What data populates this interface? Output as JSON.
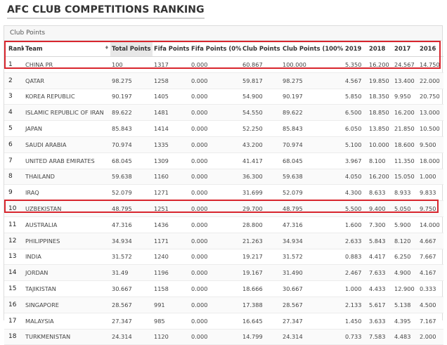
{
  "page": {
    "title": "AFC CLUB COMPETITIONS RANKING",
    "panel_title": "Club Points"
  },
  "table": {
    "columns": [
      {
        "label": "Rank",
        "sortable": false
      },
      {
        "label": "Team",
        "sortable": true
      },
      {
        "label": "Total Points",
        "sortable": true,
        "sorted": "desc"
      },
      {
        "label": "Fifa Points",
        "sortable": true
      },
      {
        "label": "Fifa Points (0%)",
        "sortable": true
      },
      {
        "label": "Club Points",
        "sortable": true
      },
      {
        "label": "Club Points (100%)",
        "sortable": true
      },
      {
        "label": "2019",
        "sortable": false
      },
      {
        "label": "2018",
        "sortable": false
      },
      {
        "label": "2017",
        "sortable": false
      },
      {
        "label": "2016",
        "sortable": false
      }
    ],
    "rows": [
      [
        "1",
        "CHINA PR",
        "100",
        "1317",
        "0.000",
        "60.867",
        "100.000",
        "5.350",
        "16.200",
        "24.567",
        "14.750"
      ],
      [
        "2",
        "QATAR",
        "98.275",
        "1258",
        "0.000",
        "59.817",
        "98.275",
        "4.567",
        "19.850",
        "13.400",
        "22.000"
      ],
      [
        "3",
        "KOREA REPUBLIC",
        "90.197",
        "1405",
        "0.000",
        "54.900",
        "90.197",
        "5.850",
        "18.350",
        "9.950",
        "20.750"
      ],
      [
        "4",
        "ISLAMIC REPUBLIC OF IRAN",
        "89.622",
        "1481",
        "0.000",
        "54.550",
        "89.622",
        "6.500",
        "18.850",
        "16.200",
        "13.000"
      ],
      [
        "5",
        "JAPAN",
        "85.843",
        "1414",
        "0.000",
        "52.250",
        "85.843",
        "6.050",
        "13.850",
        "21.850",
        "10.500"
      ],
      [
        "6",
        "SAUDI ARABIA",
        "70.974",
        "1335",
        "0.000",
        "43.200",
        "70.974",
        "5.100",
        "10.000",
        "18.600",
        "9.500"
      ],
      [
        "7",
        "UNITED ARAB EMIRATES",
        "68.045",
        "1309",
        "0.000",
        "41.417",
        "68.045",
        "3.967",
        "8.100",
        "11.350",
        "18.000"
      ],
      [
        "8",
        "THAILAND",
        "59.638",
        "1160",
        "0.000",
        "36.300",
        "59.638",
        "4.050",
        "16.200",
        "15.050",
        "1.000"
      ],
      [
        "9",
        "IRAQ",
        "52.079",
        "1271",
        "0.000",
        "31.699",
        "52.079",
        "4.300",
        "8.633",
        "8.933",
        "9.833"
      ],
      [
        "10",
        "UZBEKISTAN",
        "48.795",
        "1251",
        "0.000",
        "29.700",
        "48.795",
        "5.500",
        "9.400",
        "5.050",
        "9.750"
      ],
      [
        "11",
        "AUSTRALIA",
        "47.316",
        "1436",
        "0.000",
        "28.800",
        "47.316",
        "1.600",
        "7.300",
        "5.900",
        "14.000"
      ],
      [
        "12",
        "PHILIPPINES",
        "34.934",
        "1171",
        "0.000",
        "21.263",
        "34.934",
        "2.633",
        "5.843",
        "8.120",
        "4.667"
      ],
      [
        "13",
        "INDIA",
        "31.572",
        "1240",
        "0.000",
        "19.217",
        "31.572",
        "0.883",
        "4.417",
        "6.250",
        "7.667"
      ],
      [
        "14",
        "JORDAN",
        "31.49",
        "1196",
        "0.000",
        "19.167",
        "31.490",
        "2.467",
        "7.633",
        "4.900",
        "4.167"
      ],
      [
        "15",
        "TAJIKISTAN",
        "30.667",
        "1158",
        "0.000",
        "18.666",
        "30.667",
        "1.000",
        "4.433",
        "12.900",
        "0.333"
      ],
      [
        "16",
        "SINGAPORE",
        "28.567",
        "991",
        "0.000",
        "17.388",
        "28.567",
        "2.133",
        "5.617",
        "5.138",
        "4.500"
      ],
      [
        "17",
        "MALAYSIA",
        "27.347",
        "985",
        "0.000",
        "16.645",
        "27.347",
        "1.450",
        "3.633",
        "4.395",
        "7.167"
      ],
      [
        "18",
        "TURKMENISTAN",
        "24.314",
        "1120",
        "0.000",
        "14.799",
        "24.314",
        "0.733",
        "7.583",
        "4.483",
        "2.000"
      ]
    ]
  },
  "colors": {
    "highlight_border": "#d8262e",
    "sorted_header_bg": "#e8e8e8"
  },
  "icons": {
    "sort_both": "♦",
    "sort_desc": "▾"
  }
}
